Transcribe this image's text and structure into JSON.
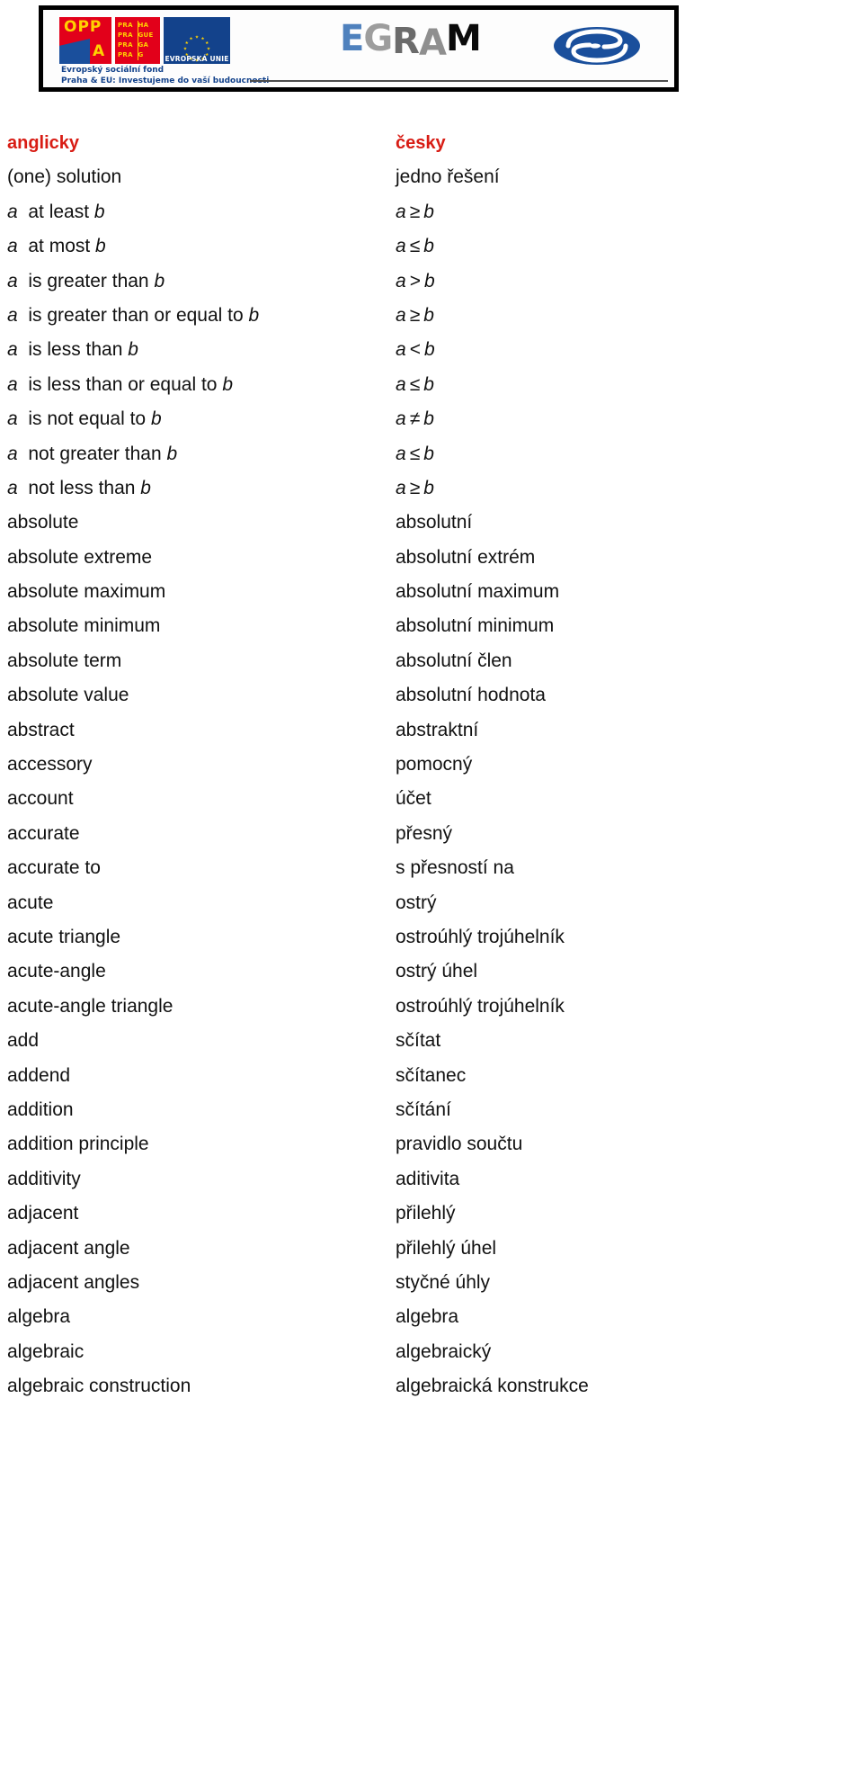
{
  "banner": {
    "oppa_logo": {
      "opp_text": "OPP",
      "a_text": "A",
      "praha_left": [
        "PRA",
        "PRA",
        "PRA",
        "PRA"
      ],
      "praha_right": [
        "HA",
        "GUE",
        "GA",
        "G"
      ],
      "eu_label": "EVROPSKÁ UNIE",
      "esf_line1": "Evropský sociální fond",
      "esf_line2": "Praha & EU: Investujeme do vaší budoucnosti"
    },
    "wordmark": {
      "letters": [
        "E",
        "G",
        "R",
        "A",
        "M"
      ],
      "colors": [
        "#4f81bd",
        "#9d9d9d",
        "#6b6b6b",
        "#8f8f8f",
        "#0a0a0a"
      ]
    },
    "oval_mark_color": "#1a4f9c"
  },
  "glossary": {
    "header": {
      "en": "anglicky",
      "cs": "česky",
      "color": "#d81c14"
    },
    "rows": [
      {
        "en_html": "(one) solution",
        "cs_html": "jedno řešení"
      },
      {
        "en_html": "<i>a</i>&nbsp; at least <i>b</i>",
        "cs_html": "<span class=\"math\">a<span class=\"op\">≥</span>b</span>"
      },
      {
        "en_html": "<i>a</i>&nbsp; at most <i>b</i>",
        "cs_html": "<span class=\"math\">a<span class=\"op\">≤</span>b</span>"
      },
      {
        "en_html": "<i>a</i>&nbsp; is greater than <i>b</i>",
        "cs_html": "<span class=\"math\">a<span class=\"op\">&gt;</span>b</span>"
      },
      {
        "en_html": "<i>a</i>&nbsp; is greater than or equal to <i>b</i>",
        "cs_html": "<span class=\"math\">a<span class=\"op\">≥</span>b</span>"
      },
      {
        "en_html": "<i>a</i>&nbsp; is less than <i>b</i>",
        "cs_html": "<span class=\"math\">a<span class=\"op\">&lt;</span>b</span>"
      },
      {
        "en_html": "<i>a</i>&nbsp; is less than or equal to <i>b</i>",
        "cs_html": "<span class=\"math\">a<span class=\"op\">≤</span>b</span>"
      },
      {
        "en_html": "<i>a</i>&nbsp; is not equal to <i>b</i>",
        "cs_html": "<span class=\"math\">a<span class=\"op\">≠</span>b</span>"
      },
      {
        "en_html": "<i>a</i>&nbsp; not greater than <i>b</i>",
        "cs_html": "<span class=\"math\">a<span class=\"op\">≤</span>b</span>"
      },
      {
        "en_html": "<i>a</i>&nbsp; not less than <i>b</i>",
        "cs_html": "<span class=\"math\">a<span class=\"op\">≥</span>b</span>"
      },
      {
        "en_html": "absolute",
        "cs_html": "absolutní"
      },
      {
        "en_html": "absolute extreme",
        "cs_html": "absolutní extrém"
      },
      {
        "en_html": "absolute maximum",
        "cs_html": "absolutní maximum"
      },
      {
        "en_html": "absolute minimum",
        "cs_html": "absolutní minimum"
      },
      {
        "en_html": "absolute term",
        "cs_html": "absolutní člen"
      },
      {
        "en_html": "absolute value",
        "cs_html": "absolutní hodnota"
      },
      {
        "en_html": "abstract",
        "cs_html": "abstraktní"
      },
      {
        "en_html": "accessory",
        "cs_html": "pomocný"
      },
      {
        "en_html": "account",
        "cs_html": "účet"
      },
      {
        "en_html": "accurate",
        "cs_html": "přesný"
      },
      {
        "en_html": "accurate to",
        "cs_html": "s přesností na"
      },
      {
        "en_html": "acute",
        "cs_html": "ostrý"
      },
      {
        "en_html": "acute triangle",
        "cs_html": "ostroúhlý trojúhelník"
      },
      {
        "en_html": "acute-angle",
        "cs_html": "ostrý úhel"
      },
      {
        "en_html": "acute-angle triangle",
        "cs_html": "ostroúhlý trojúhelník"
      },
      {
        "en_html": "add",
        "cs_html": "sčítat"
      },
      {
        "en_html": "addend",
        "cs_html": "sčítanec"
      },
      {
        "en_html": "addition",
        "cs_html": "sčítání"
      },
      {
        "en_html": "addition principle",
        "cs_html": "pravidlo součtu"
      },
      {
        "en_html": "additivity",
        "cs_html": "aditivita"
      },
      {
        "en_html": "adjacent",
        "cs_html": "přilehlý"
      },
      {
        "en_html": "adjacent angle",
        "cs_html": "přilehlý úhel"
      },
      {
        "en_html": "adjacent angles",
        "cs_html": "styčné úhly"
      },
      {
        "en_html": "algebra",
        "cs_html": "algebra"
      },
      {
        "en_html": "algebraic",
        "cs_html": "algebraický"
      },
      {
        "en_html": "algebraic construction",
        "cs_html": "algebraická konstrukce"
      }
    ]
  }
}
